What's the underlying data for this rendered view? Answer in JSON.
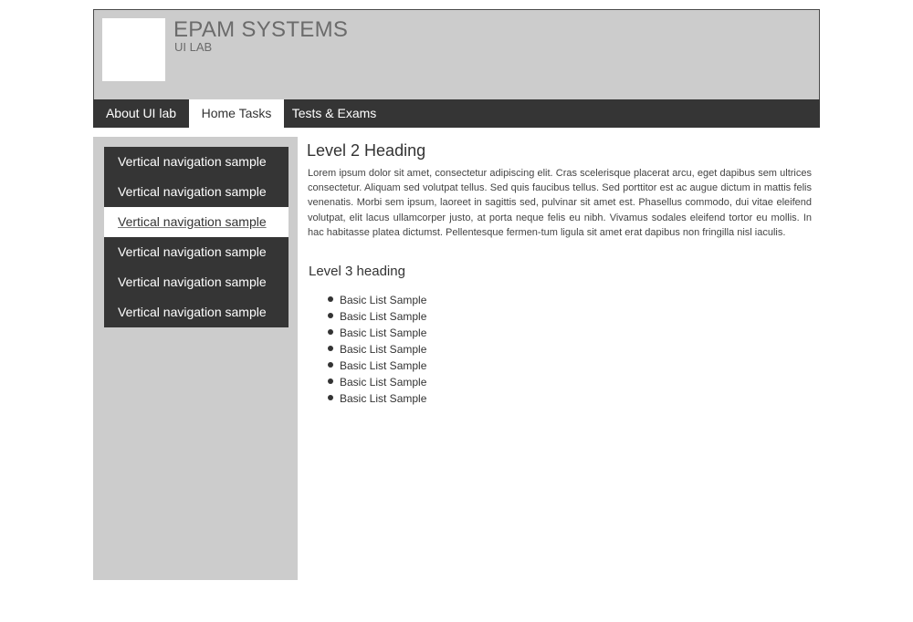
{
  "header": {
    "title": "EPAM SYSTEMS",
    "subtitle": "UI LAB"
  },
  "topnav": {
    "tabs": [
      {
        "label": "About UI lab",
        "active": false
      },
      {
        "label": "Home Tasks",
        "active": true
      },
      {
        "label": "Tests & Exams",
        "active": false
      }
    ]
  },
  "sidebar": {
    "items": [
      {
        "label": "Vertical navigation sample",
        "active": false
      },
      {
        "label": "Vertical navigation sample",
        "active": false
      },
      {
        "label": "Vertical navigation sample",
        "active": true
      },
      {
        "label": "Vertical navigation sample",
        "active": false
      },
      {
        "label": "Vertical navigation sample",
        "active": false
      },
      {
        "label": "Vertical navigation sample",
        "active": false
      }
    ]
  },
  "main": {
    "heading2": "Level 2 Heading",
    "paragraph": "Lorem ipsum dolor sit amet, consectetur adipiscing elit. Cras scelerisque placerat arcu, eget dapibus sem ultrices consectetur. Aliquam sed volutpat tellus. Sed quis faucibus tellus. Sed porttitor est ac augue dictum in mattis felis venenatis. Morbi sem ipsum, laoreet in sagittis sed, pulvinar sit amet est. Phasellus commodo, dui vitae eleifend volutpat, elit lacus ullamcorper justo, at porta neque felis eu nibh. Vivamus sodales eleifend tortor eu mollis. In hac habitasse platea dictumst. Pellentesque fermen-tum ligula sit amet erat dapibus non fringilla nisl iaculis.",
    "heading3": "Level 3 heading",
    "list": [
      "Basic List Sample",
      "Basic List Sample",
      "Basic List Sample",
      "Basic List Sample",
      "Basic List Sample",
      "Basic List Sample",
      "Basic List Sample"
    ]
  },
  "colors": {
    "panel_gray": "#cccccc",
    "dark_nav": "#353535",
    "active_bg": "#ffffff",
    "brand_text": "#6b6b6b"
  }
}
